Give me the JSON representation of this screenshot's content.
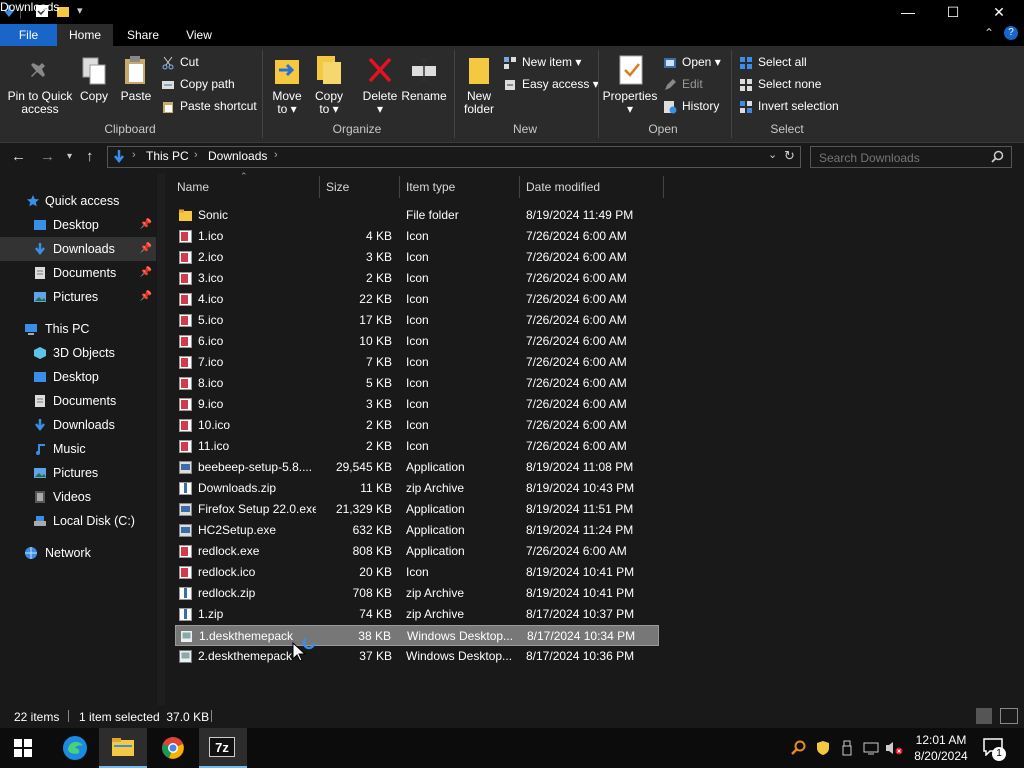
{
  "window": {
    "title": "Downloads",
    "controls": {
      "minimize": "—",
      "maximize": "☐",
      "close": "✕"
    }
  },
  "ribbon": {
    "tabs": [
      "File",
      "Home",
      "Share",
      "View"
    ],
    "clipboard": {
      "pin_label_1": "Pin to Quick",
      "pin_label_2": "access",
      "copy": "Copy",
      "paste": "Paste",
      "cut": "Cut",
      "copy_path": "Copy path",
      "paste_shortcut": "Paste shortcut",
      "group": "Clipboard"
    },
    "organize": {
      "move_to_1": "Move",
      "move_to_2": "to",
      "copy_to_1": "Copy",
      "copy_to_2": "to",
      "delete": "Delete",
      "rename": "Rename",
      "group": "Organize"
    },
    "new": {
      "new_folder_1": "New",
      "new_folder_2": "folder",
      "new_item": "New item",
      "easy_access": "Easy access",
      "group": "New"
    },
    "open": {
      "properties": "Properties",
      "open": "Open",
      "edit": "Edit",
      "history": "History",
      "group": "Open"
    },
    "select": {
      "select_all": "Select all",
      "select_none": "Select none",
      "invert_selection": "Invert selection",
      "group": "Select"
    }
  },
  "address": {
    "crumbs": [
      "This PC",
      "Downloads"
    ],
    "search_placeholder": "Search Downloads"
  },
  "nav": {
    "quick_access": "Quick access",
    "quick_items": [
      "Desktop",
      "Downloads",
      "Documents",
      "Pictures"
    ],
    "this_pc": "This PC",
    "pc_items": [
      "3D Objects",
      "Desktop",
      "Documents",
      "Downloads",
      "Music",
      "Pictures",
      "Videos",
      "Local Disk (C:)"
    ],
    "network": "Network"
  },
  "columns": {
    "name": "Name",
    "size": "Size",
    "type": "Item type",
    "date": "Date modified"
  },
  "files": [
    {
      "name": "Sonic",
      "size": "",
      "type": "File folder",
      "date": "8/19/2024 11:49 PM",
      "icon": "folder-icon"
    },
    {
      "name": "1.ico",
      "size": "4 KB",
      "type": "Icon",
      "date": "7/26/2024 6:00 AM",
      "icon": "ico-icon"
    },
    {
      "name": "2.ico",
      "size": "3 KB",
      "type": "Icon",
      "date": "7/26/2024 6:00 AM",
      "icon": "ico-icon"
    },
    {
      "name": "3.ico",
      "size": "2 KB",
      "type": "Icon",
      "date": "7/26/2024 6:00 AM",
      "icon": "ico-icon"
    },
    {
      "name": "4.ico",
      "size": "22 KB",
      "type": "Icon",
      "date": "7/26/2024 6:00 AM",
      "icon": "ico-icon"
    },
    {
      "name": "5.ico",
      "size": "17 KB",
      "type": "Icon",
      "date": "7/26/2024 6:00 AM",
      "icon": "ico-icon"
    },
    {
      "name": "6.ico",
      "size": "10 KB",
      "type": "Icon",
      "date": "7/26/2024 6:00 AM",
      "icon": "ico-icon"
    },
    {
      "name": "7.ico",
      "size": "7 KB",
      "type": "Icon",
      "date": "7/26/2024 6:00 AM",
      "icon": "ico-icon"
    },
    {
      "name": "8.ico",
      "size": "5 KB",
      "type": "Icon",
      "date": "7/26/2024 6:00 AM",
      "icon": "ico-icon"
    },
    {
      "name": "9.ico",
      "size": "3 KB",
      "type": "Icon",
      "date": "7/26/2024 6:00 AM",
      "icon": "ico-icon"
    },
    {
      "name": "10.ico",
      "size": "2 KB",
      "type": "Icon",
      "date": "7/26/2024 6:00 AM",
      "icon": "ico-icon"
    },
    {
      "name": "11.ico",
      "size": "2 KB",
      "type": "Icon",
      "date": "7/26/2024 6:00 AM",
      "icon": "ico-icon"
    },
    {
      "name": "beebeep-setup-5.8....",
      "size": "29,545 KB",
      "type": "Application",
      "date": "8/19/2024 11:08 PM",
      "icon": "app-icon"
    },
    {
      "name": "Downloads.zip",
      "size": "11 KB",
      "type": "zip Archive",
      "date": "8/19/2024 10:43 PM",
      "icon": "zip-icon"
    },
    {
      "name": "Firefox Setup 22.0.exe",
      "size": "21,329 KB",
      "type": "Application",
      "date": "8/19/2024 11:51 PM",
      "icon": "app-icon"
    },
    {
      "name": "HC2Setup.exe",
      "size": "632 KB",
      "type": "Application",
      "date": "8/19/2024 11:24 PM",
      "icon": "app-icon"
    },
    {
      "name": "redlock.exe",
      "size": "808 KB",
      "type": "Application",
      "date": "7/26/2024 6:00 AM",
      "icon": "ico-icon"
    },
    {
      "name": "redlock.ico",
      "size": "20 KB",
      "type": "Icon",
      "date": "8/19/2024 10:41 PM",
      "icon": "ico-icon"
    },
    {
      "name": "redlock.zip",
      "size": "708 KB",
      "type": "zip Archive",
      "date": "8/19/2024 10:41 PM",
      "icon": "zip-icon"
    },
    {
      "name": "1.zip",
      "size": "74 KB",
      "type": "zip Archive",
      "date": "8/17/2024 10:37 PM",
      "icon": "zip-icon"
    },
    {
      "name": "1.deskthemepack",
      "size": "38 KB",
      "type": "Windows Desktop...",
      "date": "8/17/2024 10:34 PM",
      "icon": "themepack-icon",
      "selected": true
    },
    {
      "name": "2.deskthemepack",
      "size": "37 KB",
      "type": "Windows Desktop...",
      "date": "8/17/2024 10:36 PM",
      "icon": "themepack-icon"
    }
  ],
  "status": {
    "count": "22 items",
    "selection": "1 item selected  37.0 KB"
  },
  "taskbar": {
    "time": "12:01 AM",
    "date": "8/20/2024",
    "notif_count": "1"
  },
  "colors": {
    "accent": "#1a66c8",
    "selection": "#777777",
    "folder": "#f5c842",
    "ico_red": "#d23b4b"
  }
}
